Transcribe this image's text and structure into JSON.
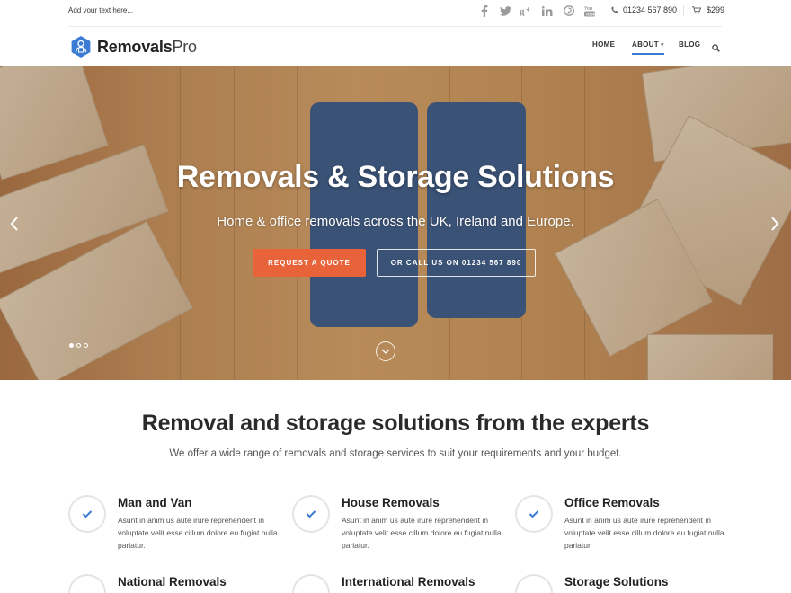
{
  "topbar": {
    "tagline": "Add your text here...",
    "socials": [
      "facebook-icon",
      "twitter-icon",
      "google-plus-icon",
      "linkedin-icon",
      "pinterest-icon",
      "youtube-icon"
    ],
    "phone": "01234 567 890",
    "cart_total": "$299"
  },
  "header": {
    "logo_bold": "Removals",
    "logo_light": "Pro",
    "nav": [
      {
        "label": "HOME"
      },
      {
        "label": "ABOUT"
      },
      {
        "label": "BLOG"
      }
    ]
  },
  "hero": {
    "title": "Removals & Storage Solutions",
    "subtitle": "Home & office removals across the UK, Ireland and Europe.",
    "primary_button": "REQUEST A QUOTE",
    "secondary_button": "OR CALL US ON 01234 567 890",
    "slides": 3,
    "active_slide": 1
  },
  "intro": {
    "title": "Removal and storage solutions from the experts",
    "subtitle": "We offer a wide range of removals and storage services to suit your requirements and your budget."
  },
  "features": [
    {
      "title": "Man and Van",
      "desc": "Asunt in anim us aute irure reprehenderit in voluptate velit esse cillum dolore eu fugiat nulla pariatur."
    },
    {
      "title": "House Removals",
      "desc": "Asunt in anim us aute irure reprehenderit in voluptate velit esse cillum dolore eu fugiat nulla pariatur."
    },
    {
      "title": "Office Removals",
      "desc": "Asunt in anim us aute irure reprehenderit in voluptate velit esse cillum dolore eu fugiat nulla pariatur."
    },
    {
      "title": "National Removals",
      "desc": ""
    },
    {
      "title": "International Removals",
      "desc": ""
    },
    {
      "title": "Storage Solutions",
      "desc": ""
    }
  ],
  "colors": {
    "accent_blue": "#3b7bd4",
    "cta_orange": "#e8623a"
  }
}
